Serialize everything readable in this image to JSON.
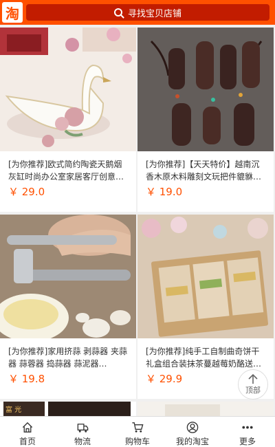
{
  "header": {
    "logo_text": "淘",
    "search_placeholder": "寻找宝贝店铺"
  },
  "products": [
    {
      "title": "[为你推荐]欧式简约陶瓷天鹅烟灰缸时尚办公室家居客厅创意…",
      "price": "￥ 29.0"
    },
    {
      "title": "[为你推荐]【天天特价】越南沉香木原木料雕刻文玩把件貔貅…",
      "price": "￥ 19.0"
    },
    {
      "title": "[为你推荐]家用挤蒜 剥蒜器 夹蒜器 蒜蓉器 捣蒜器 蒜泥器…",
      "price": "￥ 19.8"
    },
    {
      "title": "[为你推荐]纯手工自制曲奇饼干礼盒组合装抹茶蔓越莓奶酪送…",
      "price": "￥ 29.9"
    }
  ],
  "partial_label": "富 光",
  "back_to_top": {
    "label": "顶部"
  },
  "tabbar": [
    {
      "label": "首页",
      "icon": "home-icon"
    },
    {
      "label": "物流",
      "icon": "truck-icon"
    },
    {
      "label": "购物车",
      "icon": "cart-icon"
    },
    {
      "label": "我的淘宝",
      "icon": "user-icon"
    },
    {
      "label": "更多",
      "icon": "more-icon"
    }
  ],
  "colors": {
    "brand": "#ff5000",
    "search_bg": "#c21c00"
  }
}
